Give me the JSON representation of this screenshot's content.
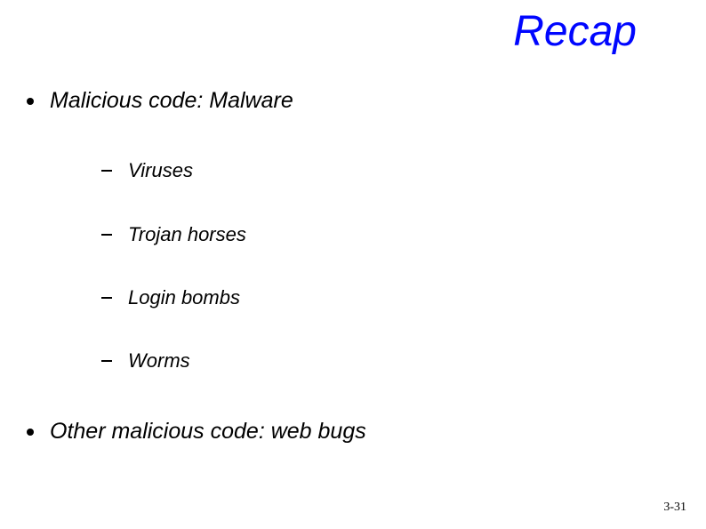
{
  "title": "Recap",
  "bullets": [
    {
      "text": "Malicious code: Malware",
      "children": [
        {
          "text": "Viruses"
        },
        {
          "text": "Trojan horses"
        },
        {
          "text": "Login bombs"
        },
        {
          "text": "Worms"
        }
      ]
    },
    {
      "text": "Other malicious code: web bugs",
      "children": []
    }
  ],
  "page_number": "3-31"
}
